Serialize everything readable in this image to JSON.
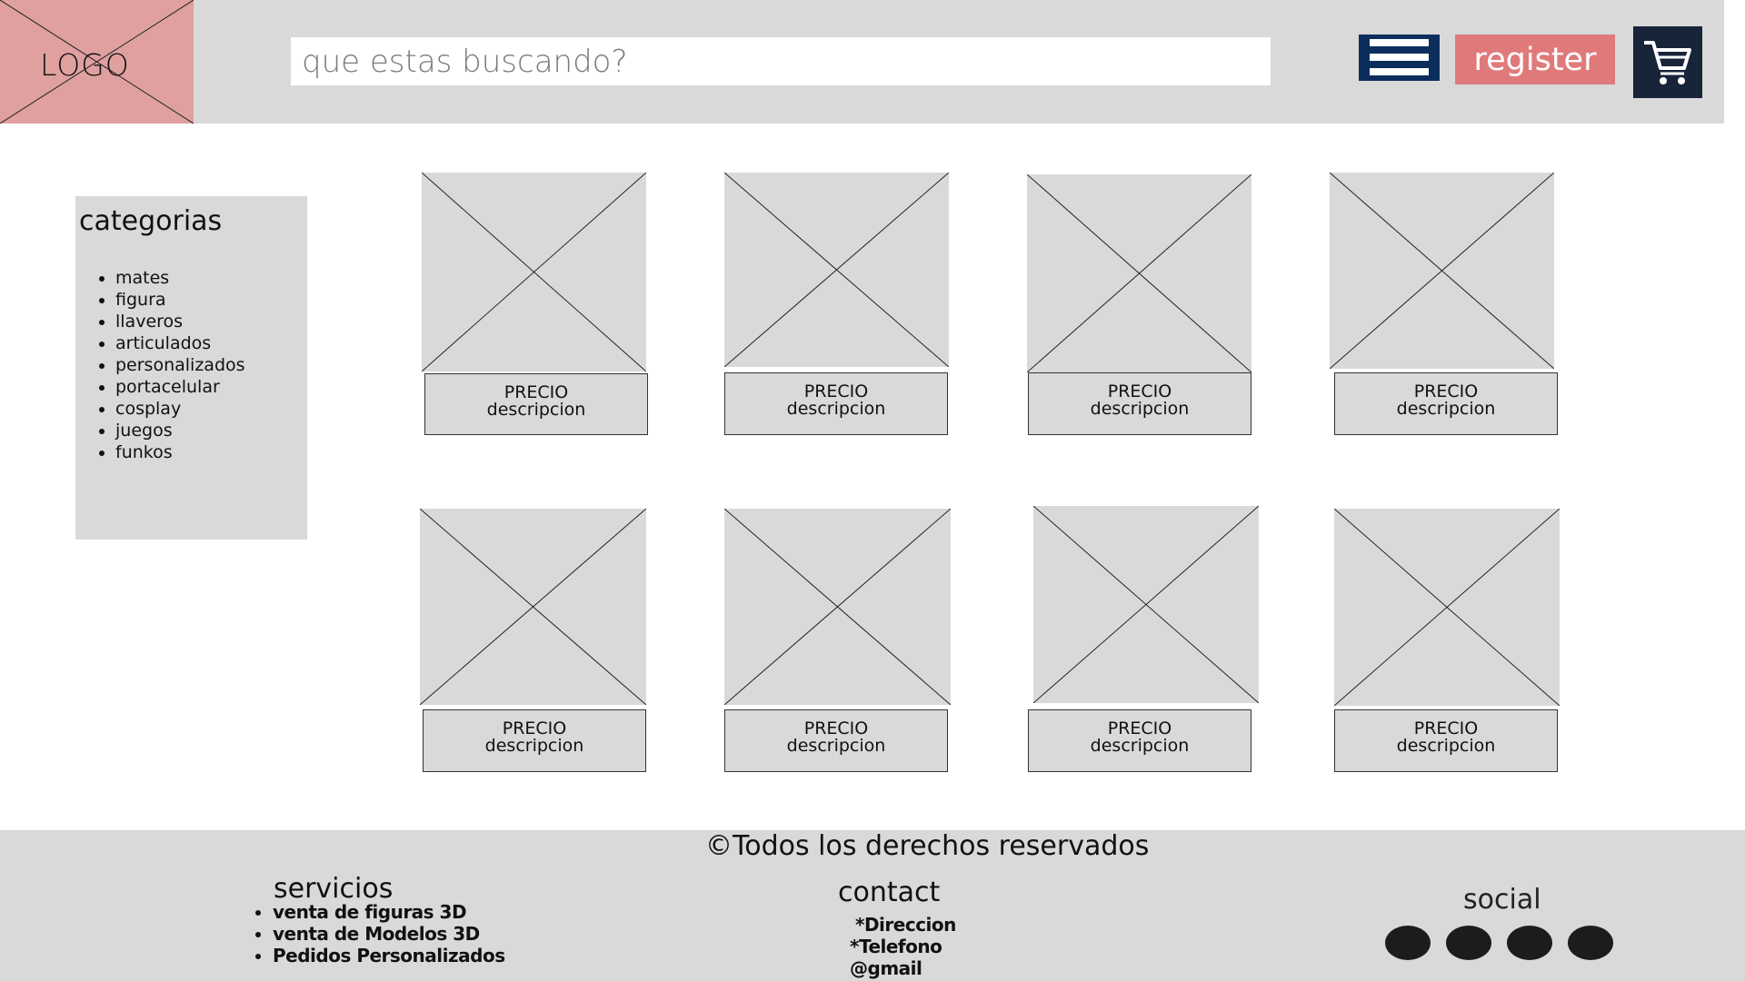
{
  "header": {
    "logo_text": "LOGO",
    "search_placeholder": "que estas buscando?",
    "register_label": "register",
    "menu_icon": "hamburger-menu-icon",
    "cart_icon": "shopping-cart-icon",
    "colors": {
      "bar": "#d9d9d9",
      "logo": "#e0a0a0",
      "menu": "#0c2e5c",
      "register": "#e07a7a",
      "cart": "#18243a"
    }
  },
  "sidebar": {
    "title": "categorias",
    "items": [
      "mates",
      "figura",
      "llaveros",
      "articulados",
      "personalizados",
      "portacelular",
      "cosplay",
      "juegos",
      "funkos"
    ]
  },
  "products": [
    {
      "price": "PRECIO",
      "description": "descripcion"
    },
    {
      "price": "PRECIO",
      "description": "descripcion"
    },
    {
      "price": "PRECIO",
      "description": "descripcion"
    },
    {
      "price": "PRECIO",
      "description": "descripcion"
    },
    {
      "price": "PRECIO",
      "description": "descripcion"
    },
    {
      "price": "PRECIO",
      "description": "descripcion"
    },
    {
      "price": "PRECIO",
      "description": "descripcion"
    },
    {
      "price": "PRECIO",
      "description": "descripcion"
    }
  ],
  "footer": {
    "copyright": "©Todos los derechos reservados",
    "services": {
      "title": "servicios",
      "items": [
        "venta de figuras 3D",
        "venta de Modelos 3D",
        "Pedidos Personalizados"
      ]
    },
    "contact": {
      "title": "contact",
      "lines": [
        "*Direccion",
        "*Telefono",
        "@gmail"
      ]
    },
    "social": {
      "title": "social"
    }
  }
}
